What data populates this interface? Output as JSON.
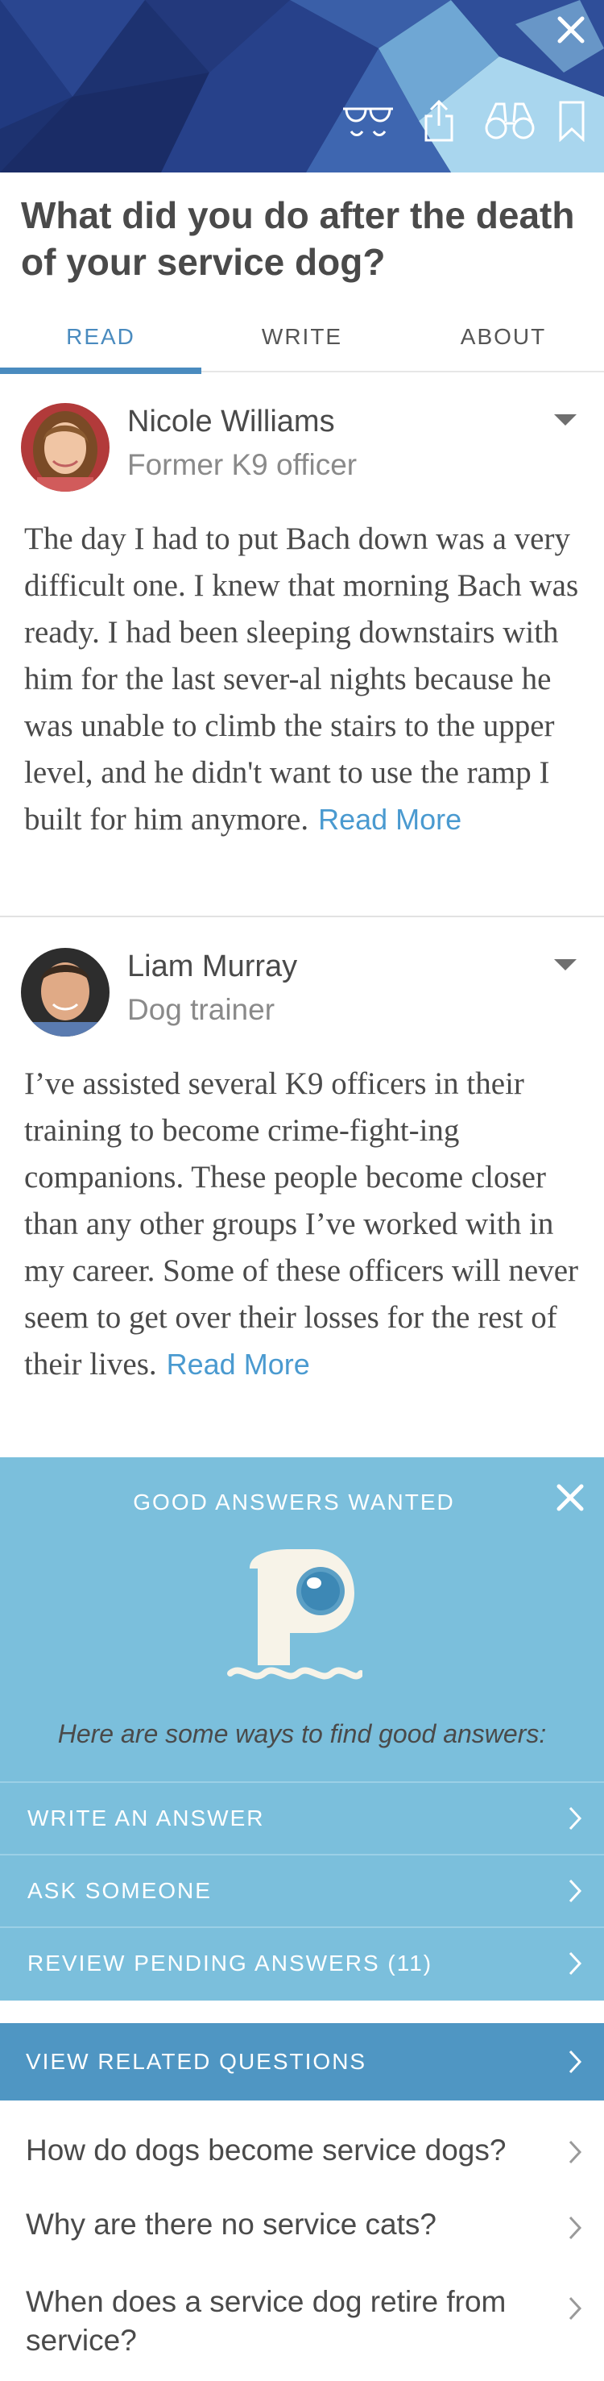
{
  "header": {
    "close_icon": "close-icon",
    "action_icons": [
      "glasses-icon",
      "share-icon",
      "binoculars-icon",
      "bookmark-icon"
    ],
    "colors": {
      "banner_dark": "#1c2f6e",
      "banner_light": "#8fc7e6"
    }
  },
  "question": "What did you do after the death of your service dog?",
  "tabs": [
    {
      "label": "READ",
      "active": true
    },
    {
      "label": "WRITE",
      "active": false
    },
    {
      "label": "ABOUT",
      "active": false
    }
  ],
  "answers": [
    {
      "name": "Nicole Williams",
      "role": "Former K9 officer",
      "body": "The day I had to put Bach down was a very difficult one. I knew that morning Bach was ready. I had been sleeping downstairs with him for the last sever-al nights because he was unable to climb the stairs to the upper level, and he didn't want to use the ramp I built for him anymore.",
      "more": "Read More"
    },
    {
      "name": "Liam Murray",
      "role": "Dog trainer",
      "body": "I’ve assisted several K9 officers in their training to become crime-fight-ing companions. These people become closer than any other groups I’ve worked with in my career. Some of these officers will never seem to get over their losses for the rest of their lives.",
      "more": "Read More"
    }
  ],
  "wanted": {
    "title": "GOOD ANSWERS WANTED",
    "hint": "Here are some ways to find good answers:",
    "options": [
      {
        "label": "WRITE AN ANSWER"
      },
      {
        "label": "ASK SOMEONE"
      },
      {
        "label": "REVIEW PENDING ANSWERS (11)"
      }
    ],
    "color": "#7bbfdc"
  },
  "related": {
    "header": "VIEW RELATED QUESTIONS",
    "items": [
      {
        "label": "How do dogs become service dogs?"
      },
      {
        "label": "Why are there no service cats?"
      },
      {
        "label": "When does a service dog retire from service?"
      }
    ],
    "color": "#4f96c3"
  },
  "accent": "#4a8bbf"
}
